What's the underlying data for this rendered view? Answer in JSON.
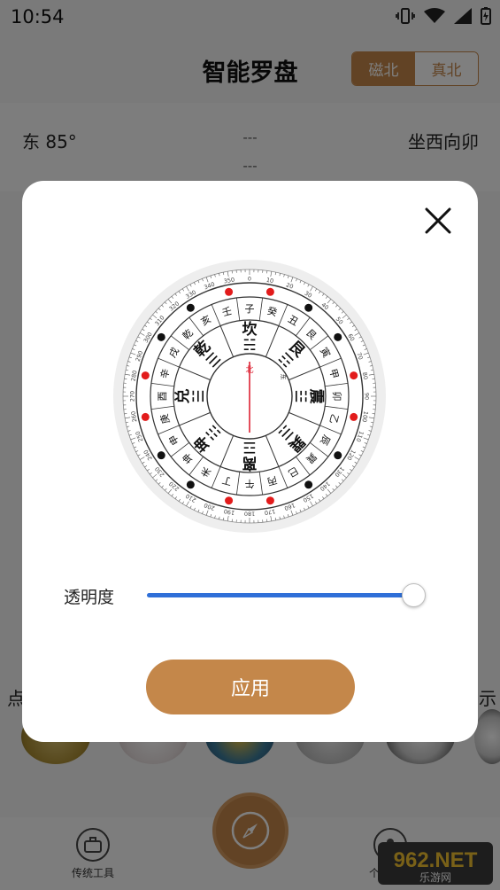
{
  "status_bar": {
    "time": "10:54"
  },
  "app_bar": {
    "title": "智能罗盘",
    "toggle": {
      "magnetic": "磁北",
      "true_north": "真北",
      "selected": "磁北"
    }
  },
  "info": {
    "left": "东 85°",
    "middle_top": "---",
    "middle_bottom": "---",
    "right": "坐西向卯"
  },
  "background_partial_text": {
    "left": "点",
    "right": "示"
  },
  "bottom_nav": {
    "left_label": "传统工具",
    "right_label": "个人中心"
  },
  "colors": {
    "accent": "#c4874a",
    "slider": "#2f6fd8",
    "dot_red": "#e21b1b"
  },
  "dialog": {
    "close_icon": "close-icon",
    "opacity_label": "透明度",
    "opacity_value": 1.0,
    "apply_label": "应用",
    "compass": {
      "center_label": "北",
      "pointer_label": "东",
      "mountains_24": [
        "子",
        "癸",
        "丑",
        "艮",
        "寅",
        "甲",
        "卯",
        "乙",
        "辰",
        "巽",
        "巳",
        "丙",
        "午",
        "丁",
        "未",
        "坤",
        "申",
        "庚",
        "酉",
        "辛",
        "戌",
        "乾",
        "亥",
        "壬"
      ],
      "trigrams": [
        {
          "name": "坎",
          "symbol": "☵"
        },
        {
          "name": "艮",
          "symbol": "☶"
        },
        {
          "name": "震",
          "symbol": "☳"
        },
        {
          "name": "巽",
          "symbol": "☴"
        },
        {
          "name": "离",
          "symbol": "☲"
        },
        {
          "name": "坤",
          "symbol": "☷"
        },
        {
          "name": "兑",
          "symbol": "☱"
        },
        {
          "name": "乾",
          "symbol": "☰"
        }
      ],
      "degree_labels": [
        "0",
        "10",
        "20",
        "30",
        "40",
        "50",
        "60",
        "70",
        "80",
        "90",
        "100",
        "110",
        "120",
        "130",
        "140",
        "150",
        "160",
        "170",
        "180",
        "190",
        "200",
        "210",
        "220",
        "230",
        "240",
        "250",
        "260",
        "270",
        "280",
        "290",
        "300",
        "310",
        "320",
        "330",
        "340",
        "350"
      ]
    }
  },
  "watermark": {
    "text": "962.NET",
    "subtext": "乐游网"
  }
}
